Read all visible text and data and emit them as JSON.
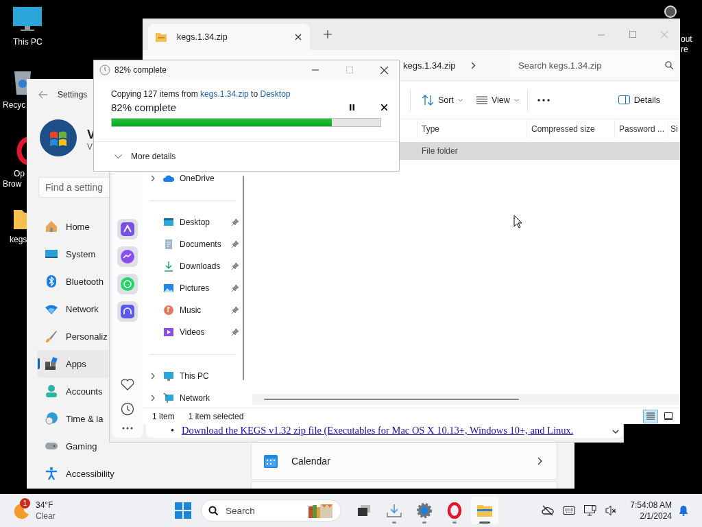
{
  "desktop": {
    "icons": [
      {
        "kind": "computer",
        "lines": [
          "This PC"
        ]
      },
      {
        "kind": "recycle-bin",
        "lines": [
          "Recyc"
        ]
      },
      {
        "kind": "browser",
        "lines": [
          "Op",
          "Brow"
        ]
      },
      {
        "kind": "folder",
        "lines": [
          "kegs"
        ]
      },
      {
        "kind": "app",
        "lines": [
          "out",
          "re"
        ]
      }
    ]
  },
  "settings": {
    "title": "Settings",
    "account": {
      "name": "V",
      "detail": "V"
    },
    "search": {
      "placeholder": "Find a setting"
    },
    "nav": [
      {
        "kind": "home",
        "label": "Home",
        "selected": false
      },
      {
        "kind": "system",
        "label": "System",
        "selected": false
      },
      {
        "kind": "bluetooth",
        "label": "Bluetooth",
        "selected": false
      },
      {
        "kind": "network",
        "label": "Network",
        "selected": false
      },
      {
        "kind": "personalization",
        "label": "Personaliz",
        "selected": false
      },
      {
        "kind": "apps",
        "label": "Apps",
        "selected": true
      },
      {
        "kind": "accounts",
        "label": "Accounts",
        "selected": false
      },
      {
        "kind": "time",
        "label": "Time & la",
        "selected": false
      },
      {
        "kind": "gaming",
        "label": "Gaming",
        "selected": false
      },
      {
        "kind": "accessibility",
        "label": "Accessibility",
        "selected": false
      }
    ],
    "cards": [
      {
        "kind": "calendar",
        "label": "Calendar"
      }
    ]
  },
  "browser": {
    "bullets": [
      {
        "marker": "•",
        "text": "Download the KEGS v1.32 zip file (Executables for Mac OS X 10.13+, Windows 10+, and Linux."
      }
    ]
  },
  "explorer": {
    "tab": {
      "title": "kegs.1.34.zip",
      "selected": true
    },
    "address": "kegs.1.34.zip",
    "search": {
      "placeholder": "Search kegs.1.34.zip"
    },
    "toolbar": [
      {
        "kind": "sort",
        "label": "Sort"
      },
      {
        "kind": "view",
        "label": "View"
      },
      {
        "kind": "more"
      },
      {
        "kind": "details",
        "label": "Details"
      }
    ],
    "columns": [
      "Type",
      "Compressed size",
      "Password ...",
      "Si"
    ],
    "rows": [
      {
        "type": "File folder",
        "selected": true
      }
    ],
    "nav_groups": [
      [
        {
          "kind": "cloud",
          "label": "OneDrive",
          "expandable": true,
          "pinned": false
        }
      ],
      [
        {
          "kind": "desktop",
          "label": "Desktop",
          "expandable": false,
          "pinned": true
        },
        {
          "kind": "documents",
          "label": "Documents",
          "expandable": false,
          "pinned": true
        },
        {
          "kind": "downloads",
          "label": "Downloads",
          "expandable": false,
          "pinned": true
        },
        {
          "kind": "pictures",
          "label": "Pictures",
          "expandable": false,
          "pinned": true
        },
        {
          "kind": "music",
          "label": "Music",
          "expandable": false,
          "pinned": true
        },
        {
          "kind": "videos",
          "label": "Videos",
          "expandable": false,
          "pinned": true
        }
      ],
      [
        {
          "kind": "computer",
          "label": "This PC",
          "expandable": true,
          "pinned": false
        },
        {
          "kind": "network",
          "label": "Network",
          "expandable": true,
          "pinned": false
        }
      ]
    ],
    "status": {
      "count": "1 item",
      "selection": "1 item selected"
    },
    "view_modes": [
      {
        "kind": "details",
        "selected": true
      },
      {
        "kind": "tiles",
        "selected": false
      }
    ]
  },
  "copy_dialog": {
    "title": "82% complete",
    "maximize_disabled": true,
    "message": {
      "prefix": "Copying 127 items from ",
      "source": "kegs.1.34.zip",
      "middle": " to ",
      "destination": "Desktop"
    },
    "status": "82% complete",
    "level": 0.82,
    "details_label": "More details"
  },
  "taskbar": {
    "weather": {
      "badge": "1",
      "temperature": "34°F",
      "condition": "Clear"
    },
    "search": {
      "placeholder": "Search"
    },
    "apps": [
      {
        "kind": "task-view",
        "running": false,
        "selected": false
      },
      {
        "kind": "download",
        "running": true,
        "selected": false
      },
      {
        "kind": "settings",
        "running": true,
        "selected": false
      },
      {
        "kind": "opera",
        "running": true,
        "selected": false
      },
      {
        "kind": "explorer",
        "running": true,
        "selected": true
      }
    ],
    "time": "7:54:08 AM",
    "date": "2/1/2024"
  }
}
